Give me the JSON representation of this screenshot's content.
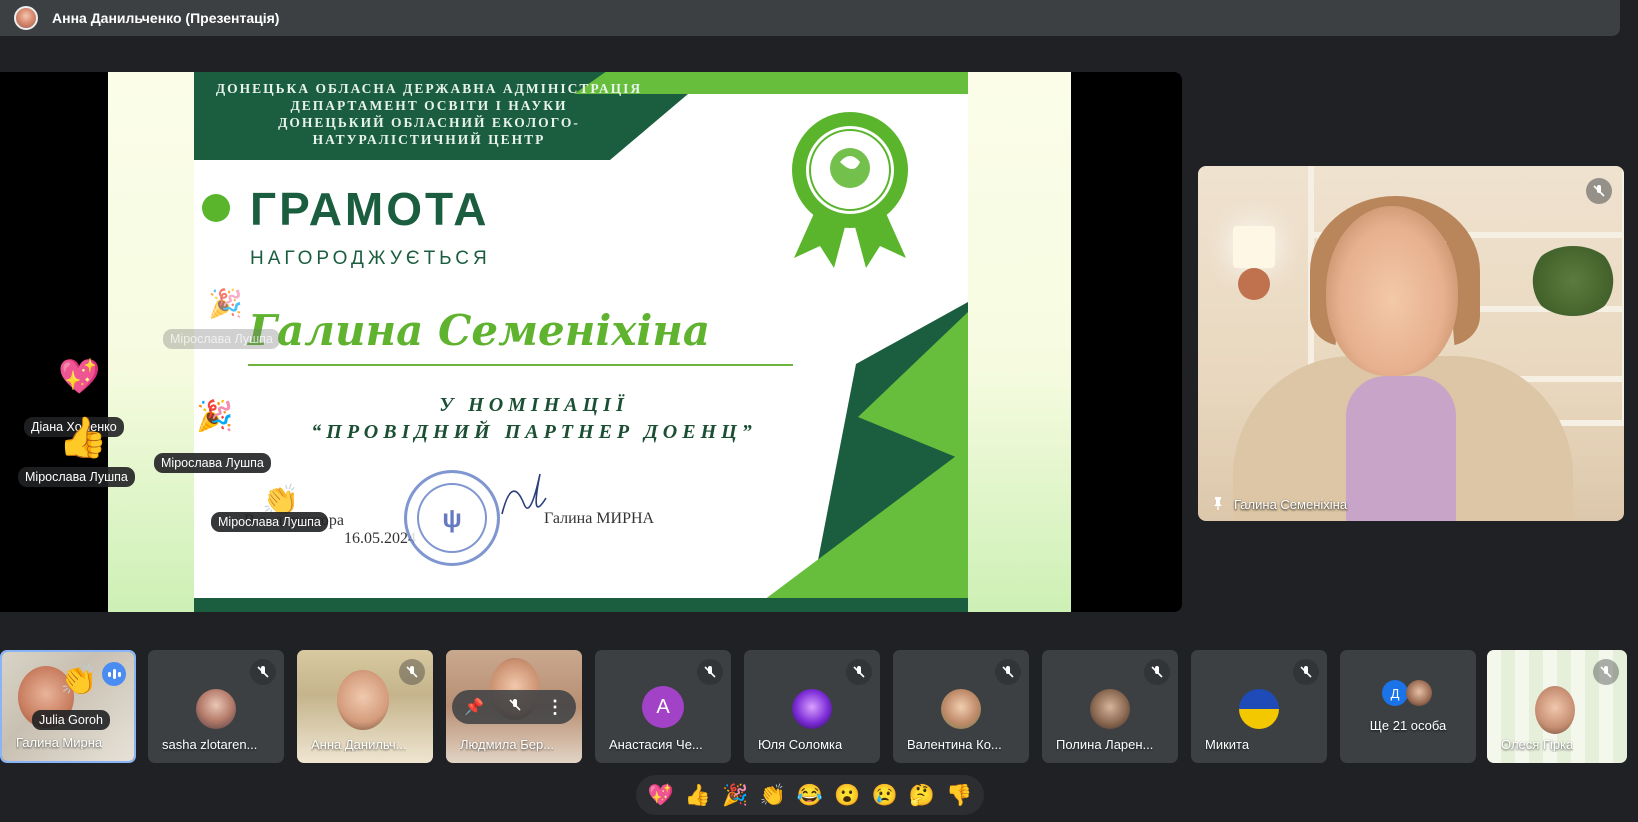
{
  "topbar": {
    "title": "Анна Данильченко (Презентація)"
  },
  "certificate": {
    "org_lines": [
      "ДОНЕЦЬКА ОБЛАСНА ДЕРЖАВНА АДМІНІСТРАЦІЯ",
      "ДЕПАРТАМЕНТ ОСВІТИ І НАУКИ",
      "ДОНЕЦЬКИЙ ОБЛАСНИЙ ЕКОЛОГО-",
      "НАТУРАЛІСТИЧНИЙ ЦЕНТР"
    ],
    "title": "ГРАМОТА",
    "subtitle": "НАГОРОДЖУЄТЬСЯ",
    "recipient": "Галина Семеніхіна",
    "nomination_line1": "У НОМІНАЦІЇ",
    "nomination_line2": "“ПРОВІДНИЙ ПАРТНЕР ДОЕНЦ”",
    "signer_role": "В.о. директора",
    "date": "16.05.2024",
    "signer_name": "Галина МИРНА"
  },
  "reactions_overlay": {
    "label_1": "Мірослава Лушпа",
    "label_2": "Діана Хоменко",
    "label_3": "Мірослава Лушпа",
    "label_4": "Мірослава Лушпа",
    "label_5": "Мірослава Лушпа"
  },
  "speaker": {
    "name": "Галина Семеніхіна"
  },
  "participants": [
    {
      "name": "Галина Мирна",
      "badge": "Julia Goroh"
    },
    {
      "name": "sasha zlotaren..."
    },
    {
      "name": "Анна Данильч..."
    },
    {
      "name": "Людмила Бер..."
    },
    {
      "name": "Анастасия Че...",
      "letter": "А"
    },
    {
      "name": "Юля Соломка"
    },
    {
      "name": "Валентина Ко..."
    },
    {
      "name": "Полина Ларен..."
    },
    {
      "name": "Микита"
    },
    {
      "name": "Ще 21 особа",
      "letter": "Д"
    },
    {
      "name": "Олеся Гірка"
    }
  ],
  "reaction_bar": [
    "💖",
    "👍",
    "🎉",
    "👏",
    "😂",
    "😮",
    "😢",
    "🤔",
    "👎"
  ],
  "colors": {
    "cert_dark_green": "#1b5e3f",
    "cert_light_green": "#67bd3c",
    "meet_bg": "#202124",
    "tile_bg": "#3c4043",
    "active_border": "#8ab4f8"
  }
}
